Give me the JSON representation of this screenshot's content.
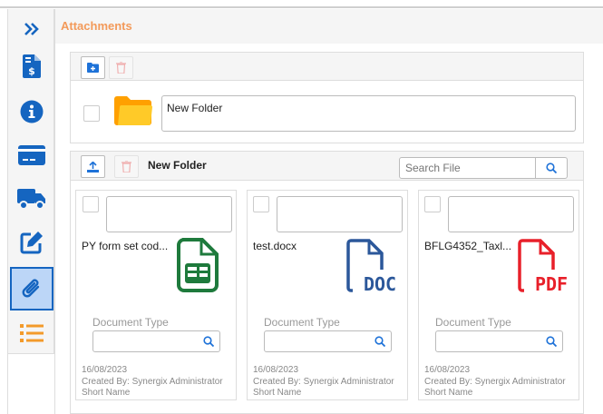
{
  "header": {
    "title": "Attachments"
  },
  "sidebar": {
    "items": [
      {
        "name": "expand",
        "icon": "double-chevron-right-icon"
      },
      {
        "name": "invoice",
        "icon": "invoice-dollar-icon"
      },
      {
        "name": "info",
        "icon": "info-icon"
      },
      {
        "name": "payment",
        "icon": "credit-card-icon"
      },
      {
        "name": "delivery",
        "icon": "truck-icon"
      },
      {
        "name": "edit",
        "icon": "edit-icon"
      },
      {
        "name": "attachments",
        "icon": "paperclip-icon",
        "active": true
      },
      {
        "name": "list",
        "icon": "list-icon"
      }
    ]
  },
  "folders": {
    "items": [
      {
        "name": "New Folder"
      }
    ]
  },
  "files": {
    "current_folder": "New Folder",
    "search_placeholder": "Search File",
    "items": [
      {
        "name": "PY form set cod...",
        "type": "sheet",
        "doc_type_label": "Document Type",
        "date": "16/08/2023",
        "created_by": "Created By: Synergix Administrator",
        "short_name": "Short Name"
      },
      {
        "name": "test.docx",
        "type": "doc",
        "icon_text": "DOC",
        "doc_type_label": "Document Type",
        "date": "16/08/2023",
        "created_by": "Created By: Synergix Administrator",
        "short_name": "Short Name"
      },
      {
        "name": "BFLG4352_Taxl...",
        "type": "pdf",
        "icon_text": "PDF",
        "doc_type_label": "Document Type",
        "date": "16/08/2023",
        "created_by": "Created By: Synergix Administrator",
        "short_name": "Short Name"
      }
    ]
  },
  "colors": {
    "accent": "#1565c0",
    "title": "#f39a5a",
    "sheet": "#1e7a3c",
    "doc": "#2b579a",
    "pdf": "#e8202a"
  }
}
